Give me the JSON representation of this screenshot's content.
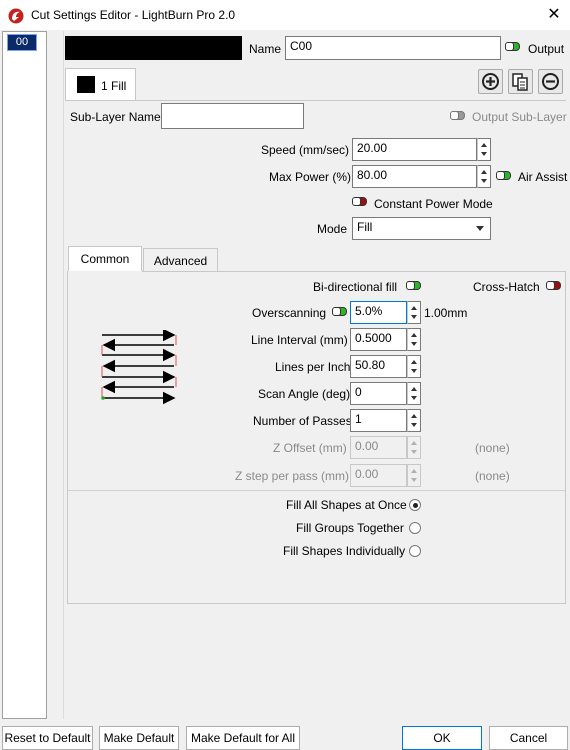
{
  "window": {
    "title": "Cut Settings Editor - LightBurn Pro 2.0",
    "close_glyph": "✕"
  },
  "layers": [
    {
      "label": "00"
    }
  ],
  "header": {
    "name_label": "Name",
    "name_value": "C00",
    "output_label": "Output",
    "output_on": true
  },
  "sublayer_tab": {
    "label": "1 Fill"
  },
  "toolbar_icons": [
    "add-icon",
    "copy-icon",
    "remove-icon"
  ],
  "sublayer": {
    "name_label": "Sub-Layer Name",
    "name_value": "",
    "output_sublayer_label": "Output Sub-Layer",
    "output_sublayer_on": false
  },
  "speed": {
    "label": "Speed (mm/sec)",
    "value": "20.00"
  },
  "max_power": {
    "label": "Max Power (%)",
    "value": "80.00"
  },
  "air_assist": {
    "label": "Air Assist",
    "on": true
  },
  "constant_power": {
    "label": "Constant Power Mode",
    "on": false
  },
  "mode": {
    "label": "Mode",
    "value": "Fill"
  },
  "tabs": [
    {
      "label": "Common",
      "active": true
    },
    {
      "label": "Advanced",
      "active": false
    }
  ],
  "common": {
    "bidirectional_label": "Bi-directional fill",
    "bidirectional_on": true,
    "crosshatch_label": "Cross-Hatch",
    "crosshatch_on": false,
    "overscanning_label": "Overscanning",
    "overscanning_value": "5.0%",
    "overscanning_mm": "1.00mm",
    "line_interval_label": "Line Interval (mm)",
    "line_interval_value": "0.5000",
    "lpi_label": "Lines per Inch",
    "lpi_value": "50.80",
    "scan_angle_label": "Scan Angle (deg)",
    "scan_angle_value": "0",
    "passes_label": "Number of Passes",
    "passes_value": "1",
    "z_offset_label": "Z Offset (mm)",
    "z_offset_value": "0.00",
    "z_offset_note": "(none)",
    "z_step_label": "Z step per pass (mm)",
    "z_step_value": "0.00",
    "z_step_note": "(none)"
  },
  "fill_options": [
    {
      "label": "Fill All Shapes at Once",
      "selected": true
    },
    {
      "label": "Fill Groups Together",
      "selected": false
    },
    {
      "label": "Fill Shapes Individually",
      "selected": false
    }
  ],
  "buttons": {
    "reset": "Reset to Default",
    "make_default": "Make Default",
    "make_default_all": "Make Default for All",
    "ok": "OK",
    "cancel": "Cancel"
  },
  "colors": {
    "toggle_on": "#2cb52c",
    "toggle_red": "#9a1010",
    "selected_layer": "#0a2a6a",
    "ok_border": "#0078d7"
  }
}
